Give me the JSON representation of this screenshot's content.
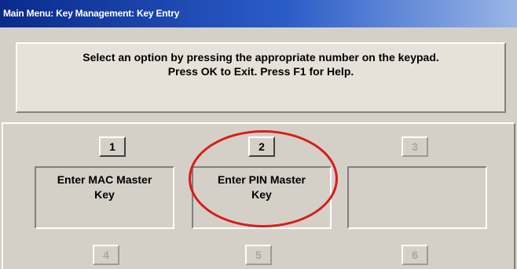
{
  "window": {
    "title": "Main Menu: Key Management: Key Entry"
  },
  "instructions": {
    "line1": "Select an option by pressing the appropriate number on the keypad.",
    "line2": "Press OK to Exit.  Press F1 for Help."
  },
  "options": [
    {
      "number": "1",
      "label_line1": "Enter MAC Master",
      "label_line2": "Key",
      "enabled": true
    },
    {
      "number": "2",
      "label_line1": "Enter PIN Master",
      "label_line2": "Key",
      "enabled": true
    },
    {
      "number": "3",
      "label_line1": "",
      "label_line2": "",
      "enabled": false
    },
    {
      "number": "4",
      "enabled": false
    },
    {
      "number": "5",
      "enabled": false
    },
    {
      "number": "6",
      "enabled": false
    }
  ],
  "annotation": {
    "color": "#d91c1c",
    "highlighted_option": "2"
  }
}
